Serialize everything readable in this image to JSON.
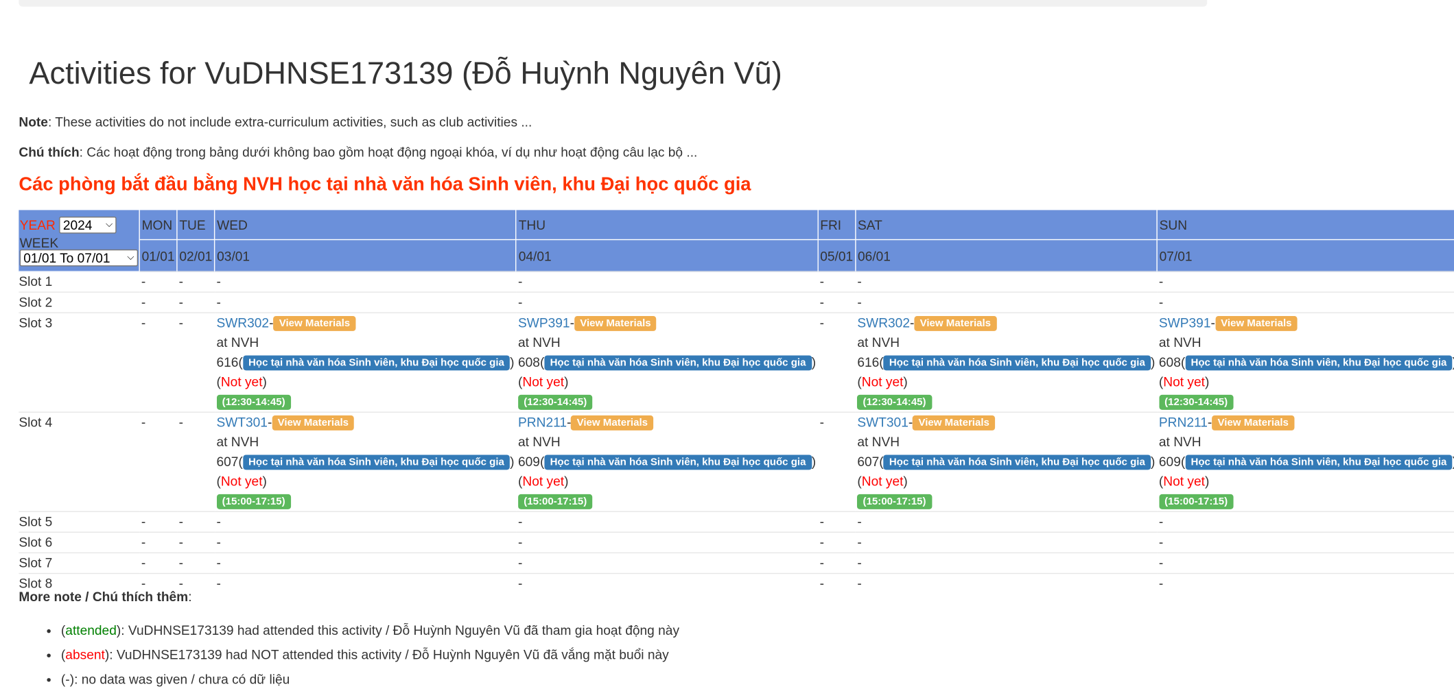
{
  "title": "Activities for VuDHNSE173139 (Đỗ Huỳnh Nguyên Vũ)",
  "note": {
    "label": "Note",
    "text": ": These activities do not include extra-curriculum activities, such as club activities ..."
  },
  "chuthich": {
    "label": "Chú thích",
    "text": ": Các hoạt động trong bảng dưới không bao gồm hoạt động ngoại khóa, ví dụ như hoạt động câu lạc bộ ..."
  },
  "headline": "Các phòng bắt đầu bằng NVH học tại nhà văn hóa Sinh viên, khu Đại học quốc gia",
  "filters": {
    "year_label": "YEAR",
    "year_value": "2024",
    "week_label": "WEEK",
    "week_value": "01/01 To 07/01"
  },
  "days": [
    {
      "name": "MON",
      "date": "01/01"
    },
    {
      "name": "TUE",
      "date": "02/01"
    },
    {
      "name": "WED",
      "date": "03/01"
    },
    {
      "name": "THU",
      "date": "04/01"
    },
    {
      "name": "FRI",
      "date": "05/01"
    },
    {
      "name": "SAT",
      "date": "06/01"
    },
    {
      "name": "SUN",
      "date": "07/01"
    }
  ],
  "empty": "-",
  "materials_label": "View Materials",
  "location_note": "Học tại nhà văn hóa Sinh viên, khu Đại học quốc gia",
  "at_prefix": "at NVH",
  "status": "Not yet",
  "slots": [
    {
      "label": "Slot 1",
      "cells": [
        null,
        null,
        null,
        null,
        null,
        null,
        null
      ]
    },
    {
      "label": "Slot 2",
      "cells": [
        null,
        null,
        null,
        null,
        null,
        null,
        null
      ]
    },
    {
      "label": "Slot 3",
      "cells": [
        null,
        null,
        {
          "course": "SWR302",
          "room": "616",
          "time": "(12:30-14:45)"
        },
        {
          "course": "SWP391",
          "room": "608",
          "time": "(12:30-14:45)"
        },
        null,
        {
          "course": "SWR302",
          "room": "616",
          "time": "(12:30-14:45)"
        },
        {
          "course": "SWP391",
          "room": "608",
          "time": "(12:30-14:45)"
        }
      ]
    },
    {
      "label": "Slot 4",
      "cells": [
        null,
        null,
        {
          "course": "SWT301",
          "room": "607",
          "time": "(15:00-17:15)"
        },
        {
          "course": "PRN211",
          "room": "609",
          "time": "(15:00-17:15)"
        },
        null,
        {
          "course": "SWT301",
          "room": "607",
          "time": "(15:00-17:15)"
        },
        {
          "course": "PRN211",
          "room": "609",
          "time": "(15:00-17:15)"
        }
      ]
    },
    {
      "label": "Slot 5",
      "cells": [
        null,
        null,
        null,
        null,
        null,
        null,
        null
      ]
    },
    {
      "label": "Slot 6",
      "cells": [
        null,
        null,
        null,
        null,
        null,
        null,
        null
      ]
    },
    {
      "label": "Slot 7",
      "cells": [
        null,
        null,
        null,
        null,
        null,
        null,
        null
      ]
    },
    {
      "label": "Slot 8",
      "cells": [
        null,
        null,
        null,
        null,
        null,
        null,
        null
      ]
    }
  ],
  "more_note": {
    "label": "More note / Chú thích thêm",
    "colon": ":"
  },
  "legend": [
    {
      "key": "attended",
      "text": ": VuDHNSE173139 had attended this activity / Đỗ Huỳnh Nguyên Vũ đã tham gia hoạt động này"
    },
    {
      "key": "absent",
      "text": ": VuDHNSE173139 had NOT attended this activity / Đỗ Huỳnh Nguyên Vũ đã vắng mặt buổi này"
    },
    {
      "key": "-",
      "text": ": no data was given / chưa có dữ liệu"
    }
  ],
  "colors": {
    "header_bg": "#6b90da",
    "headline_red": "#ff3300",
    "link_blue": "#337ab7",
    "badge_orange": "#f0ad4e",
    "badge_green": "#5cb85c",
    "attended_green": "#008000",
    "absent_red": "#ff0000"
  }
}
